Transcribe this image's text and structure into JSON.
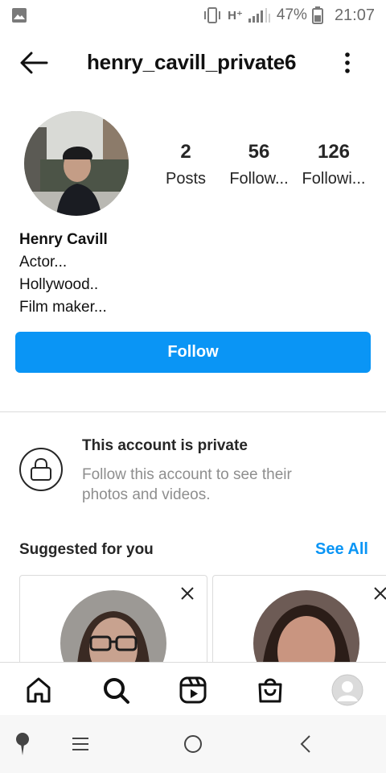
{
  "status_bar": {
    "network": "H⁺",
    "battery": "47%",
    "time": "21:07",
    "icons": [
      "image-icon",
      "vibrate-icon",
      "signal-icon",
      "battery-icon"
    ]
  },
  "header": {
    "username": "henry_cavill_private6",
    "back_icon": "arrow-left-icon",
    "more_icon": "more-vertical-icon"
  },
  "profile": {
    "stats": [
      {
        "value": "2",
        "label": "Posts"
      },
      {
        "value": "56",
        "label": "Follow..."
      },
      {
        "value": "126",
        "label": "Followi..."
      }
    ],
    "name": "Henry Cavill",
    "bio_lines": [
      "Actor...",
      "Hollywood..",
      "Film maker..."
    ]
  },
  "follow_button": {
    "label": "Follow"
  },
  "private_notice": {
    "title": "This account is private",
    "description": "Follow this account to see their photos and videos."
  },
  "suggestions": {
    "title": "Suggested for you",
    "see_all": "See All"
  },
  "bottom_nav": {
    "items": [
      "home-icon",
      "search-icon",
      "reels-icon",
      "shop-icon",
      "profile-avatar"
    ]
  },
  "system_nav": {
    "items": [
      "assistant-icon",
      "recents-icon",
      "home-circle-icon",
      "back-chevron-icon"
    ]
  },
  "colors": {
    "accent": "#0a95f5",
    "text": "#262626",
    "muted": "#8e8e8e",
    "border": "#dbdbdb"
  }
}
